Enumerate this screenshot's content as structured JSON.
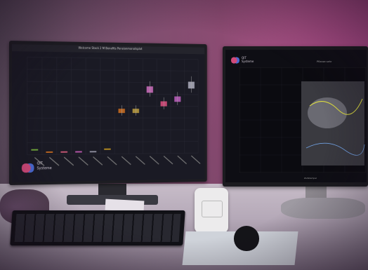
{
  "left_monitor": {
    "window_title": "Welcome Stack 2 M Benefits Pensionmonatsplot",
    "brand_line1": "QIT",
    "brand_line2": "Systeme"
  },
  "right_monitor": {
    "brand_line1": "QIT",
    "brand_line2": "Systeme",
    "window_title": "Pflanze sehr",
    "axis_label": "Zeitstempel"
  },
  "colors": {
    "accent_pink": "#c4549a",
    "chart_box_pink": "#d060a0",
    "chart_box_orange": "#d07020",
    "chart_box_green": "#80c040",
    "chart_box_gray": "#a0a0b0"
  },
  "chart_data": {
    "type": "box",
    "title": "Welcome Stack 2 M Benefits Pensionmonatsplot",
    "series": [
      {
        "color": "#80c040",
        "median": 2
      },
      {
        "color": "#d07020",
        "median": 1
      },
      {
        "color": "#e06080",
        "median": 1
      },
      {
        "color": "#d060c0",
        "median": 1
      },
      {
        "color": "#a0a0b0",
        "median": 1
      },
      {
        "color": "#d0a020",
        "median": 2
      },
      {
        "color": "#d07020",
        "median": 18
      },
      {
        "color": "#c0a040",
        "median": 18
      },
      {
        "color": "#d070c0",
        "median": 27
      },
      {
        "color": "#e05080",
        "median": 21
      },
      {
        "color": "#c060c0",
        "median": 23
      },
      {
        "color": "#b0b0c0",
        "median": 29
      }
    ]
  }
}
